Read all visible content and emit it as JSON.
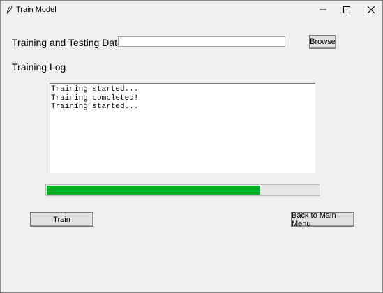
{
  "window": {
    "title": "Train Model"
  },
  "form": {
    "data_label": "Training and Testing Data",
    "data_path_value": "",
    "browse_label": "Browse",
    "log_label": "Training Log"
  },
  "log": {
    "lines": [
      "Training started...",
      "Training completed!",
      "Training started..."
    ]
  },
  "progress": {
    "value": 0.785,
    "color": "#06b025"
  },
  "actions": {
    "train_label": "Train",
    "back_label": "Back to Main Menu"
  },
  "icons": {
    "app": "feather-icon",
    "minimize": "minimize-icon",
    "maximize": "maximize-icon",
    "close": "close-icon"
  }
}
